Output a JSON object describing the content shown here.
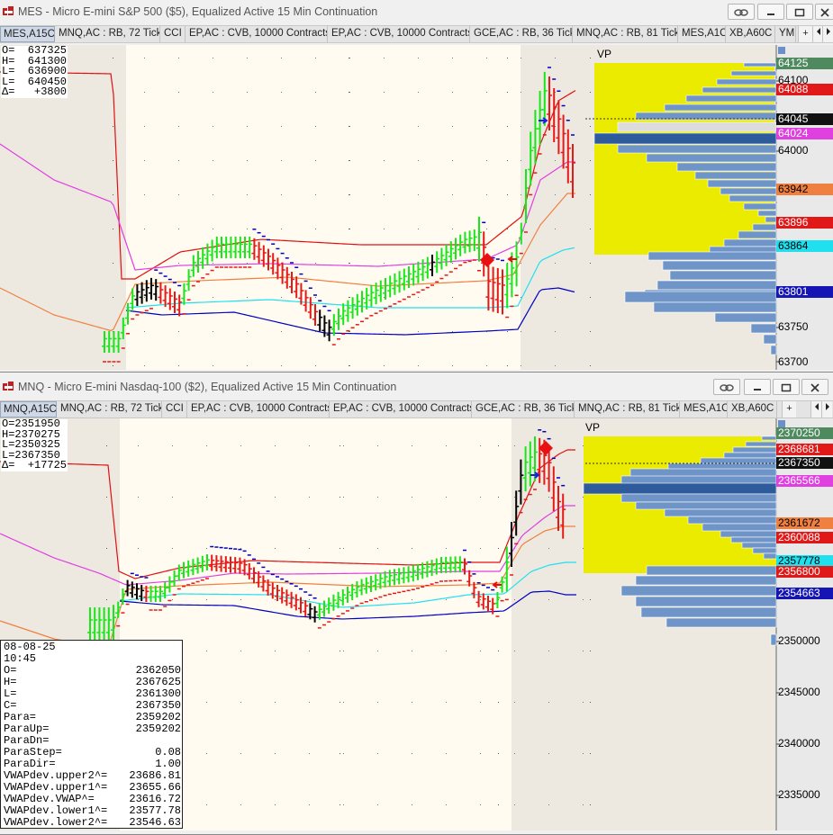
{
  "colors": {
    "bar_green": "#19e619",
    "bar_red": "#e61919",
    "bar_black": "#000000",
    "vwap_blue": "#0000c0",
    "band_red": "#e01010",
    "band_magenta": "#e040e0",
    "band_orange": "#f08040",
    "band_cyan": "#20e0f0",
    "vp_yellow": "#ebeb00",
    "vp_blue": "#6f95c8",
    "vp_poc": "#2e5b9c",
    "session_bg": "#fffbf0",
    "offhours_bg": "#ede9e1"
  },
  "top": {
    "title": "MES - Micro E-mini S&P 500 ($5), Equalized Active 15 Min Continuation",
    "tabs": [
      {
        "label": "MES,A15C",
        "active": true
      },
      {
        "label": "MNQ,AC : RB, 72 Tick"
      },
      {
        "label": "CCI"
      },
      {
        "label": "EP,AC : CVB, 10000 Contracts"
      },
      {
        "label": "EP,AC : CVB, 10000 Contracts"
      },
      {
        "label": "GCE,AC : RB, 36 Tick"
      },
      {
        "label": "MNQ,AC : RB, 81 Tick"
      },
      {
        "label": "MES,A1C"
      },
      {
        "label": "XB,A60C"
      },
      {
        "label": "YM"
      }
    ],
    "tab_add": "+",
    "ohlc": [
      "O=  637325",
      "H=  641300",
      "L=  636900",
      "L=  640450",
      "Δ=   +3800"
    ],
    "vp_label": "VP",
    "price_tags": [
      {
        "text": "64125",
        "bg": "#4f8a5f",
        "fg": "#ffffff"
      },
      {
        "text": "64088",
        "bg": "#e01818",
        "fg": "#ffffff"
      },
      {
        "text": "64045",
        "bg": "#111111",
        "fg": "#ffffff"
      },
      {
        "text": "64024",
        "bg": "#e040e0",
        "fg": "#ffffff"
      },
      {
        "text": "63942",
        "bg": "#f08040",
        "fg": "#000000"
      },
      {
        "text": "63896",
        "bg": "#e01818",
        "fg": "#ffffff"
      },
      {
        "text": "63864",
        "bg": "#20e0f0",
        "fg": "#000000"
      },
      {
        "text": "63801",
        "bg": "#1515b5",
        "fg": "#ffffff"
      }
    ],
    "axis_labels": [
      "64100",
      "64000",
      "63750",
      "63700"
    ]
  },
  "bottom": {
    "title": "MNQ - Micro E-mini Nasdaq-100 ($2), Equalized Active 15 Min Continuation",
    "tabs": [
      {
        "label": "MNQ,A15C",
        "active": true
      },
      {
        "label": "MNQ,AC : RB, 72 Tick"
      },
      {
        "label": "CCI"
      },
      {
        "label": "EP,AC : CVB, 10000 Contracts"
      },
      {
        "label": "EP,AC : CVB, 10000 Contracts"
      },
      {
        "label": "GCE,AC : RB, 36 Tick"
      },
      {
        "label": "MNQ,AC : RB, 81 Tick"
      },
      {
        "label": "MES,A1C"
      },
      {
        "label": "XB,A60C"
      }
    ],
    "tab_add": "+",
    "ohlc": [
      "O=2351950",
      "H=2370275",
      "L=2350325",
      "L=2367350",
      "Δ=  +17725"
    ],
    "vp_label": "VP",
    "price_tags": [
      {
        "text": "2370250",
        "bg": "#4f8a5f",
        "fg": "#ffffff"
      },
      {
        "text": "2368681",
        "bg": "#e01818",
        "fg": "#ffffff"
      },
      {
        "text": "2367350",
        "bg": "#111111",
        "fg": "#ffffff"
      },
      {
        "text": "2365566",
        "bg": "#e040e0",
        "fg": "#ffffff"
      },
      {
        "text": "2361672",
        "bg": "#f08040",
        "fg": "#000000"
      },
      {
        "text": "2360088",
        "bg": "#e01818",
        "fg": "#ffffff"
      },
      {
        "text": "2357778",
        "bg": "#20e0f0",
        "fg": "#000000"
      },
      {
        "text": "2356800",
        "bg": "#e01818",
        "fg": "#ffffff"
      },
      {
        "text": "2354663",
        "bg": "#1515b5",
        "fg": "#ffffff"
      }
    ],
    "axis_labels": [
      "2350000",
      "2345000",
      "2340000",
      "2335000"
    ],
    "data_window": {
      "date": "08-08-25",
      "time": "10:45",
      "rows": [
        {
          "k": "O=",
          "v": "2362050"
        },
        {
          "k": "H=",
          "v": "2367625"
        },
        {
          "k": "L=",
          "v": "2361300"
        },
        {
          "k": "C=",
          "v": "2367350"
        },
        {
          "k": "Para=",
          "v": "2359202"
        },
        {
          "k": "ParaUp=",
          "v": "2359202"
        },
        {
          "k": "ParaDn=",
          "v": ""
        },
        {
          "k": "ParaStep=",
          "v": "0.08"
        },
        {
          "k": "ParaDir=",
          "v": "1.00"
        },
        {
          "k": "VWAPdev.upper2^=",
          "v": "23686.81"
        },
        {
          "k": "VWAPdev.upper1^=",
          "v": "23655.66"
        },
        {
          "k": "VWAPdev.VWAP^=",
          "v": "23616.72"
        },
        {
          "k": "VWAPdev.lower1^=",
          "v": "23577.78"
        },
        {
          "k": "VWAPdev.lower2^=",
          "v": "23546.63"
        }
      ]
    }
  }
}
